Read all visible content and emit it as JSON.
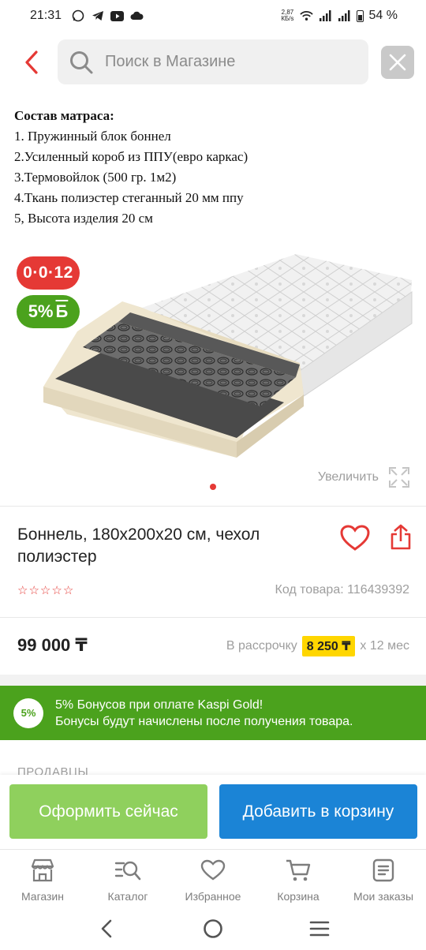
{
  "status_bar": {
    "time": "21:31",
    "net_speed_value": "2,87",
    "net_speed_unit": "КБ/s",
    "battery": "54 %",
    "icons": [
      "whatsapp-icon",
      "telegram-icon",
      "youtube-icon",
      "cloud-icon",
      "wifi-icon",
      "signal-icon",
      "signal-icon",
      "battery-icon"
    ]
  },
  "header": {
    "search_placeholder": "Поиск в Магазине"
  },
  "composition": {
    "title": "Состав матраса:",
    "lines": [
      "1. Пружинный блок боннел",
      "2.Усиленный короб из ППУ(евро каркас)",
      "3.Термовойлок   (500 гр. 1м2)",
      "4.Ткань полиэстер стеганный 20 мм ппу",
      "5, Высота изделия 20 см"
    ]
  },
  "badges": {
    "installment": "0·0·12",
    "bonus": "5%",
    "bonus_symbol": "Б"
  },
  "gallery": {
    "zoom_label": "Увеличить",
    "accent_color": "#e53935"
  },
  "product": {
    "title": " Боннель, 180x200x20 см, чехол полиэстер",
    "rating_stars": 0,
    "rating_max": 5,
    "code": "Код товара: 116439392",
    "price": "99 000 ₸",
    "installment_prefix": "В рассрочку",
    "installment_amount": "8 250 ₸",
    "installment_suffix": "x 12 мес"
  },
  "bonus_banner": {
    "circle": "5%",
    "line1": "5% Бонусов при оплате Kaspi Gold!",
    "line2": "Бонусы будут начислены после получения товара.",
    "color": "#4ba21d"
  },
  "sellers_label": "ПРОДАВЦЫ",
  "actions": {
    "order_now": "Оформить сейчас",
    "add_to_cart": "Добавить в корзину",
    "order_color": "#8fd05d",
    "cart_color": "#1b84d6"
  },
  "bottom_nav": [
    {
      "label": "Магазин",
      "icon": "store-icon"
    },
    {
      "label": "Каталог",
      "icon": "catalog-icon"
    },
    {
      "label": "Избранное",
      "icon": "heart-icon"
    },
    {
      "label": "Корзина",
      "icon": "cart-icon"
    },
    {
      "label": "Мои заказы",
      "icon": "orders-icon"
    }
  ]
}
